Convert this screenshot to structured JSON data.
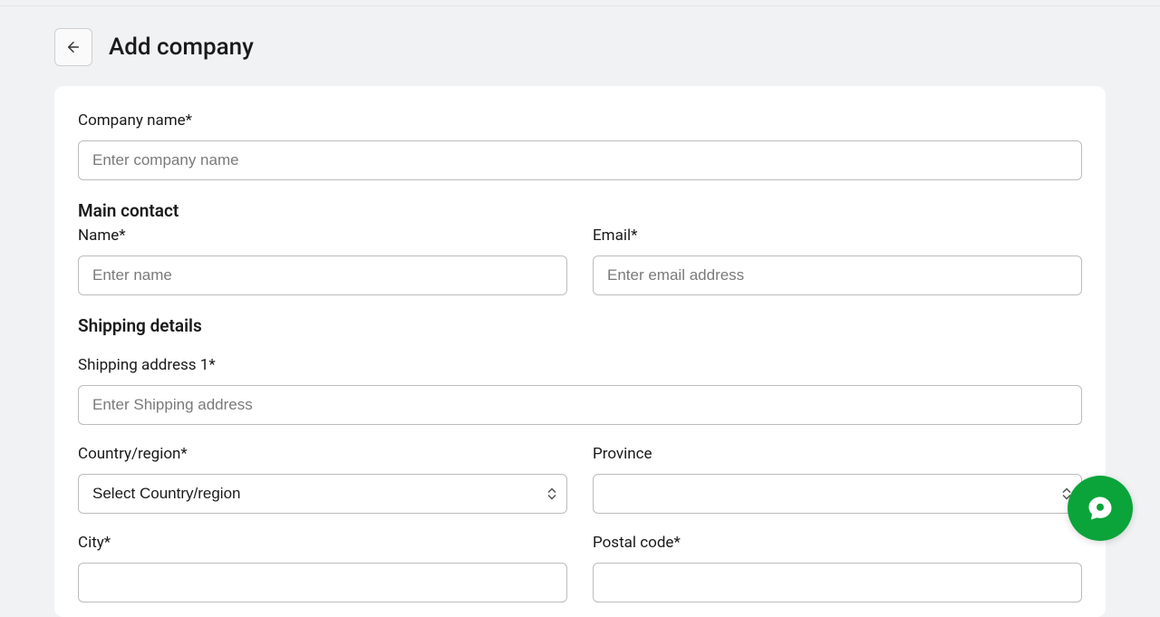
{
  "header": {
    "title": "Add company"
  },
  "form": {
    "company_name": {
      "label": "Company name*",
      "placeholder": "Enter company name",
      "value": ""
    },
    "main_contact": {
      "heading": "Main contact",
      "name": {
        "label": "Name*",
        "placeholder": "Enter name",
        "value": ""
      },
      "email": {
        "label": "Email*",
        "placeholder": "Enter email address",
        "value": ""
      }
    },
    "shipping": {
      "heading": "Shipping details",
      "address1": {
        "label": "Shipping address 1*",
        "placeholder": "Enter Shipping address",
        "value": ""
      },
      "country": {
        "label": "Country/region*",
        "selected": "Select Country/region"
      },
      "province": {
        "label": "Province",
        "selected": ""
      },
      "city": {
        "label": "City*",
        "placeholder": "",
        "value": ""
      },
      "postal": {
        "label": "Postal code*",
        "placeholder": "",
        "value": ""
      }
    }
  }
}
